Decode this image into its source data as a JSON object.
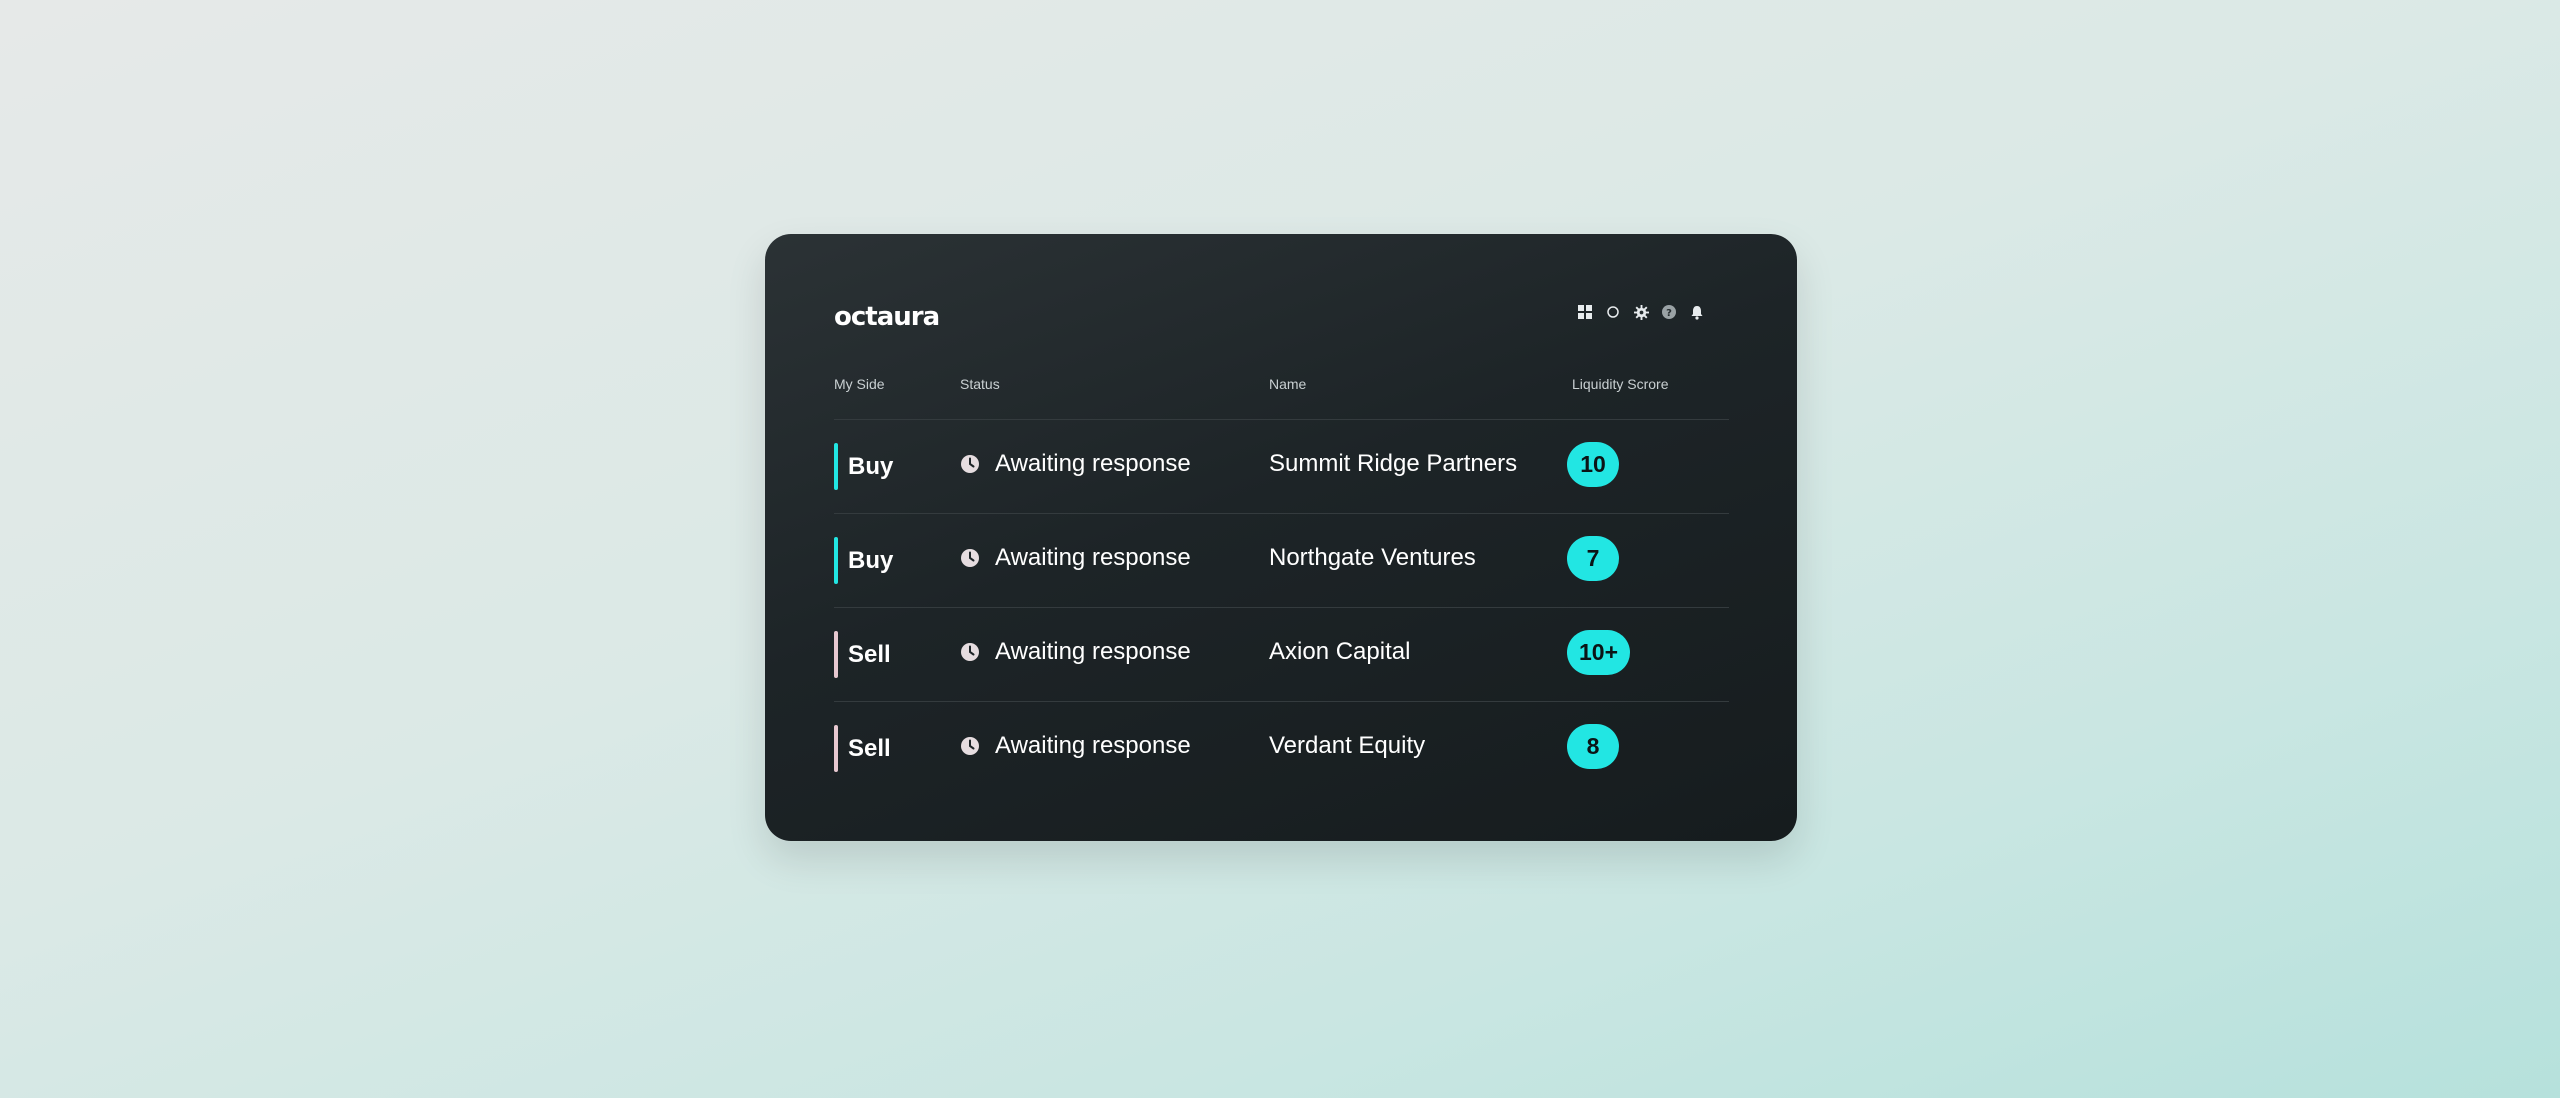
{
  "app": {
    "logo_text": "octaura"
  },
  "toolbar": {
    "icons": [
      "grid-icon",
      "refresh-icon",
      "gear-icon",
      "help-icon",
      "bell-icon"
    ]
  },
  "table": {
    "headers": {
      "side": "My Side",
      "status": "Status",
      "name": "Name",
      "score": "Liquidity Scrore"
    },
    "rows": [
      {
        "side": "Buy",
        "status": "Awaiting response",
        "name": "Summit Ridge Partners",
        "score": "10"
      },
      {
        "side": "Buy",
        "status": "Awaiting response",
        "name": "Northgate Ventures",
        "score": "7"
      },
      {
        "side": "Sell",
        "status": "Awaiting response",
        "name": "Axion Capital",
        "score": "10+"
      },
      {
        "side": "Sell",
        "status": "Awaiting response",
        "name": "Verdant Equity",
        "score": "8"
      }
    ]
  },
  "colors": {
    "accent": "#22e6e3",
    "buy_bar": "#22e6e3",
    "sell_bar": "#e7c8d0",
    "card_background": "#1d2427",
    "page_background": "#d6e8e5"
  }
}
